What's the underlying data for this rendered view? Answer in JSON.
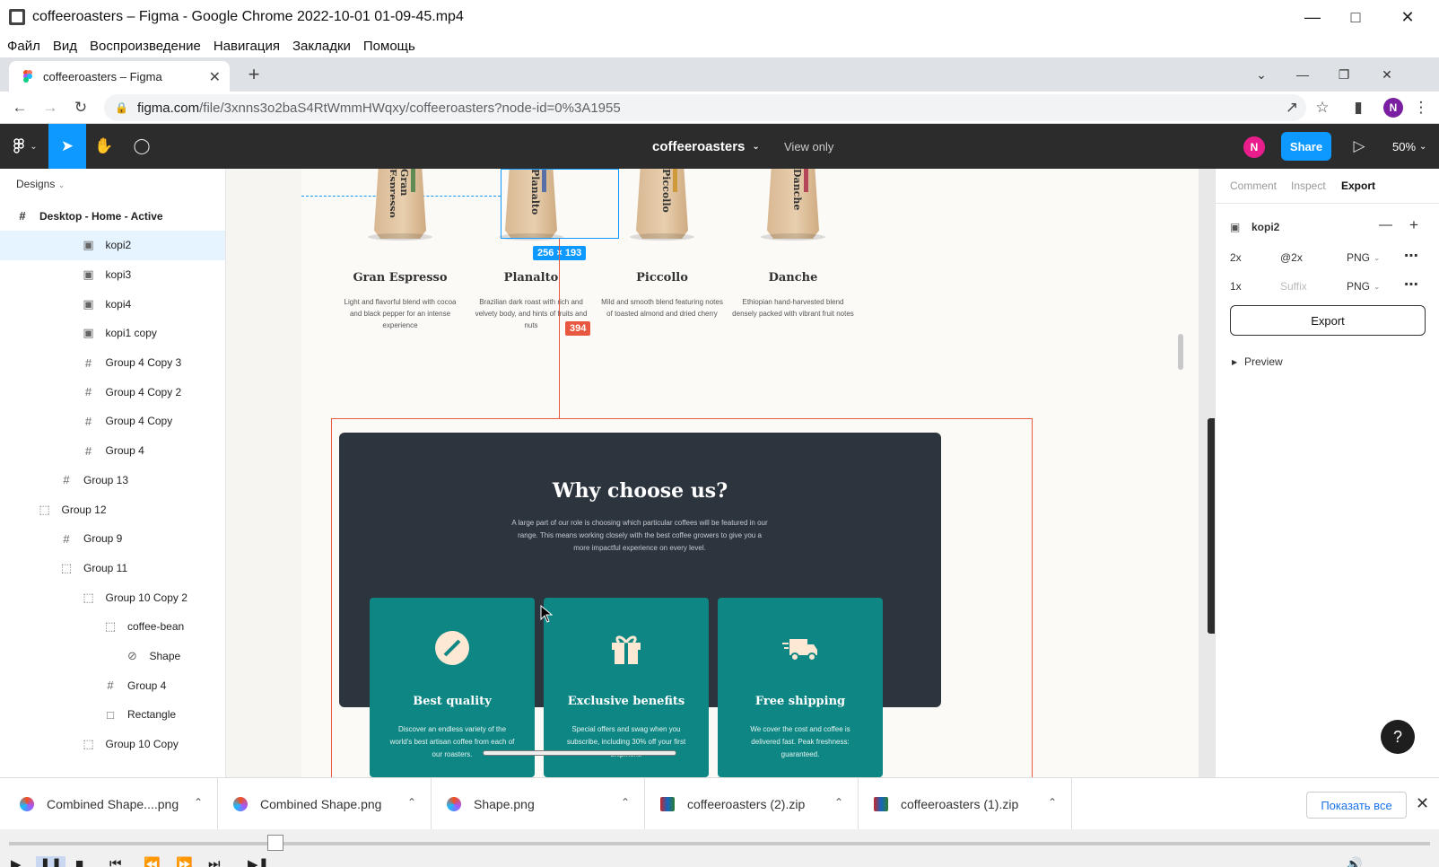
{
  "window": {
    "title": "coffeeroasters – Figma - Google Chrome 2022-10-01 01-09-45.mp4"
  },
  "menu": [
    "Файл",
    "Вид",
    "Воспроизведение",
    "Навигация",
    "Закладки",
    "Помощь"
  ],
  "browser": {
    "tab_title": "coffeeroasters – Figma",
    "url_host": "figma.com",
    "url_path": "/file/3xnns3o2baS4RtWmmHWqxy/coffeeroasters?node-id=0%3A1955",
    "profile_initial": "N"
  },
  "figma": {
    "file_name": "coffeeroasters",
    "view_mode": "View only",
    "share_label": "Share",
    "user_initial": "N",
    "zoom": "50%",
    "pages_label": "Designs",
    "layers": [
      {
        "name": "Desktop - Home - Active",
        "icon": "frame-icon",
        "indent": 0,
        "bold": true
      },
      {
        "name": "kopi2",
        "icon": "image-icon",
        "indent": 3,
        "selected": true
      },
      {
        "name": "kopi3",
        "icon": "image-icon",
        "indent": 3
      },
      {
        "name": "kopi4",
        "icon": "image-icon",
        "indent": 3
      },
      {
        "name": "kopi1 copy",
        "icon": "image-icon",
        "indent": 3
      },
      {
        "name": "Group 4 Copy 3",
        "icon": "frame-icon",
        "indent": 3
      },
      {
        "name": "Group 4 Copy 2",
        "icon": "frame-icon",
        "indent": 3
      },
      {
        "name": "Group 4 Copy",
        "icon": "frame-icon",
        "indent": 3
      },
      {
        "name": "Group 4",
        "icon": "frame-icon",
        "indent": 3
      },
      {
        "name": "Group 13",
        "icon": "frame-icon",
        "indent": 2
      },
      {
        "name": "Group 12",
        "icon": "group-icon",
        "indent": 1
      },
      {
        "name": "Group 9",
        "icon": "frame-icon",
        "indent": 2
      },
      {
        "name": "Group 11",
        "icon": "group-icon",
        "indent": 2
      },
      {
        "name": "Group 10 Copy 2",
        "icon": "group-icon",
        "indent": 3
      },
      {
        "name": "coffee-bean",
        "icon": "group-icon",
        "indent": 4
      },
      {
        "name": "Shape",
        "icon": "shape-icon",
        "indent": 5
      },
      {
        "name": "Group 4",
        "icon": "frame-icon",
        "indent": 4
      },
      {
        "name": "Rectangle",
        "icon": "rectangle-icon",
        "indent": 4
      },
      {
        "name": "Group 10 Copy",
        "icon": "group-icon",
        "indent": 3
      }
    ],
    "right_tabs": [
      "Comment",
      "Inspect",
      "Export"
    ],
    "selected_layer": "kopi2",
    "export_rows": [
      {
        "scale": "2x",
        "suffix": "@2x",
        "format": "PNG"
      },
      {
        "scale": "1x",
        "suffix": "",
        "suffix_placeholder": "Suffix",
        "format": "PNG"
      }
    ],
    "export_label": "Export",
    "preview_label": "Preview",
    "help_label": "?",
    "measure_size": "256 × 193",
    "measure_gap": "394"
  },
  "canvas": {
    "coffees": [
      {
        "name": "Gran Espresso",
        "bag_text": "Gran Espresso",
        "stripe": "#5f8a54",
        "desc": "Light and flavorful blend with cocoa and black pepper for an intense experience"
      },
      {
        "name": "Planalto",
        "bag_text": "Planalto",
        "stripe": "#5a6fa8",
        "desc": "Brazilian dark roast with rich and velvety body, and hints of fruits and nuts"
      },
      {
        "name": "Piccollo",
        "bag_text": "Piccollo",
        "stripe": "#cf9b3a",
        "desc": "Mild and smooth blend featuring notes of toasted almond and dried cherry"
      },
      {
        "name": "Danche",
        "bag_text": "Danche",
        "stripe": "#b5465a",
        "desc": "Ethiopian hand-harvested blend densely packed with vibrant fruit notes"
      }
    ],
    "why_title": "Why choose us?",
    "why_desc": "A large part of our role is choosing which particular coffees will be featured in our range. This means working closely with the best coffee growers to give you a more impactful experience on every level.",
    "cards": [
      {
        "title": "Best quality",
        "icon": "coffee-bean-icon",
        "desc": "Discover an endless variety of the world's best artisan coffee from each of our roasters."
      },
      {
        "title": "Exclusive benefits",
        "icon": "gift-icon",
        "desc": "Special offers and swag when you subscribe, including 30% off your first shipment."
      },
      {
        "title": "Free shipping",
        "icon": "truck-icon",
        "desc": "We cover the cost and coffee is delivered fast. Peak freshness: guaranteed."
      }
    ]
  },
  "downloads": [
    {
      "name": "Combined Shape....png",
      "icon": "figma-file-icon"
    },
    {
      "name": "Combined Shape.png",
      "icon": "figma-file-icon"
    },
    {
      "name": "Shape.png",
      "icon": "figma-file-icon"
    },
    {
      "name": "coffeeroasters (2).zip",
      "icon": "archive-icon"
    },
    {
      "name": "coffeeroasters (1).zip",
      "icon": "archive-icon"
    }
  ],
  "show_all_label": "Показать все",
  "colors": {
    "figma_blue": "#0d99ff",
    "teal": "#0e8784",
    "dark": "#2c343e",
    "measure_red": "#e8573f",
    "cream": "#fbfaf7"
  }
}
